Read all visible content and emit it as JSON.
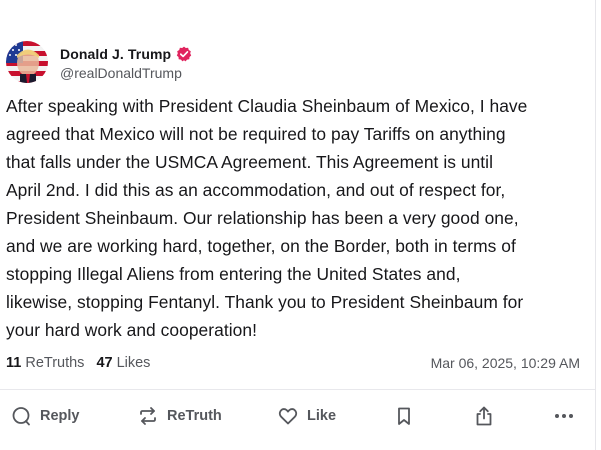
{
  "post": {
    "author": {
      "display_name": "Donald J. Trump",
      "handle": "@realDonaldTrump",
      "verified": true,
      "verified_color": "#e0245e",
      "avatar_icon": "avatar-flag-portrait"
    },
    "text": "After speaking with President Claudia Sheinbaum of Mexico, I have\nagreed that Mexico will not be required to pay Tariffs on anything\nthat falls under the USMCA Agreement. This Agreement is until\nApril 2nd. I did this as an accommodation, and out of respect for,\nPresident Sheinbaum. Our relationship has been a very good one,\nand we are working hard, together, on the Border, both in terms of\nstopping Illegal Aliens from entering the United States and,\nlikewise, stopping Fentanyl. Thank you to President Sheinbaum for\nyour hard work and cooperation!",
    "stats": {
      "retruths_count": "11",
      "retruths_label": "ReTruths",
      "likes_count": "47",
      "likes_label": "Likes"
    },
    "timestamp": "Mar 06, 2025, 10:29 AM"
  },
  "actions": {
    "reply_label": "Reply",
    "retruth_label": "ReTruth",
    "like_label": "Like",
    "icons": [
      "reply-icon",
      "retruth-icon",
      "heart-icon",
      "bookmark-icon",
      "share-icon",
      "more-icon"
    ]
  },
  "colors": {
    "text_primary": "#17171a",
    "text_secondary": "#55575c",
    "divider": "#e8e8ec"
  }
}
